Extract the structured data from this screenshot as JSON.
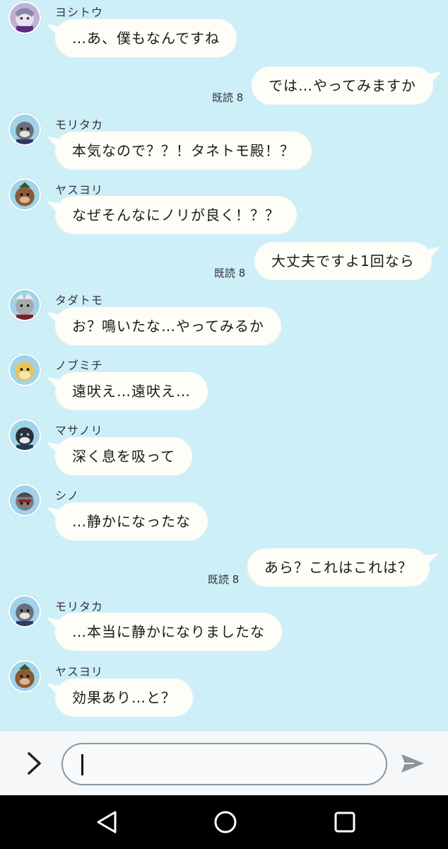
{
  "messages": [
    {
      "side": "left",
      "sender": "ヨシトウ",
      "text": "…あ、僕もなんですね",
      "avatar": "avatar-yoshitou"
    },
    {
      "side": "right",
      "text": "では…やってみますか",
      "read": "既読 8"
    },
    {
      "side": "left",
      "sender": "モリタカ",
      "text": "本気なので？？！タネトモ殿！？",
      "avatar": "avatar-moritaka"
    },
    {
      "side": "left",
      "sender": "ヤスヨリ",
      "text": "なぜそんなにノリが良く！？？",
      "avatar": "avatar-yasuyori"
    },
    {
      "side": "right",
      "text": "大丈夫ですよ1回なら",
      "read": "既読 8"
    },
    {
      "side": "left",
      "sender": "タダトモ",
      "text": "お？鳴いたな…やってみるか",
      "avatar": "avatar-tadatomo"
    },
    {
      "side": "left",
      "sender": "ノブミチ",
      "text": "遠吠え…遠吠え…",
      "avatar": "avatar-nobumichi"
    },
    {
      "side": "left",
      "sender": "マサノリ",
      "text": "深く息を吸って",
      "avatar": "avatar-masanori"
    },
    {
      "side": "left",
      "sender": "シノ",
      "text": "…静かになったな",
      "avatar": "avatar-shino"
    },
    {
      "side": "right",
      "text": "あら？これはこれは？",
      "read": "既読 8"
    },
    {
      "side": "left",
      "sender": "モリタカ",
      "text": "…本当に静かになりましたな",
      "avatar": "avatar-moritaka"
    },
    {
      "side": "left",
      "sender": "ヤスヨリ",
      "text": "効果あり…と？",
      "avatar": "avatar-yasuyori"
    }
  ],
  "input": {
    "value": "",
    "expand_icon": "chevron-right-icon",
    "send_icon": "send-icon"
  },
  "nav": {
    "back_icon": "back-triangle-icon",
    "home_icon": "home-circle-icon",
    "recents_icon": "recents-square-icon"
  },
  "colors": {
    "background": "#cdeff8",
    "bubble": "#fffdf8",
    "nav": "#000000"
  }
}
